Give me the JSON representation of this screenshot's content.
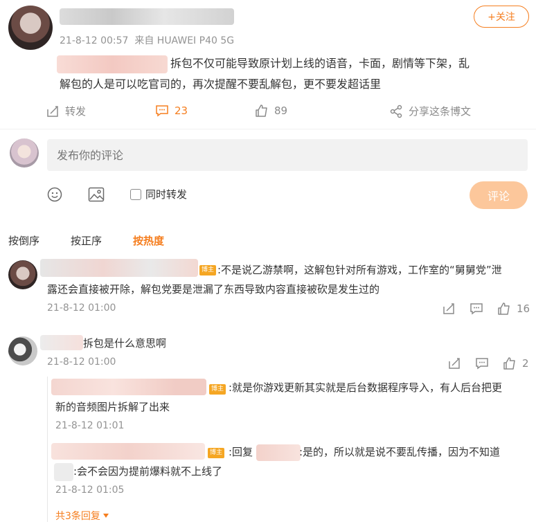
{
  "post": {
    "meta": "21-8-12 00:57  来自 HUAWEI P40 5G",
    "follow_label": "+关注",
    "text_line1": "拆包不仅可能导致原计划上线的语音，卡面，剧情等下架，乱",
    "text_line2": "解包的人是可以吃官司的，再次提醒不要乱解包，更不要发超话里",
    "actions": {
      "repost": "转发",
      "comments": "23",
      "likes": "89",
      "share": "分享这条博文"
    }
  },
  "composer": {
    "placeholder": "发布你的评论",
    "repost_label": "同时转发",
    "submit_label": "评论"
  },
  "sort": {
    "desc": "按倒序",
    "asc": "按正序",
    "hot": "按热度"
  },
  "comments": [
    {
      "badge": "博主",
      "text_line1": ":不是说乙游禁啊，这解包针对所有游戏，工作室的“舅舅党”泄",
      "text_line2": "露还会直接被开除，解包党要是泄漏了东西导致内容直接被砍是发生过的",
      "time": "21-8-12 01:00",
      "likes": "16"
    },
    {
      "text": "拆包是什么意思啊",
      "time": "21-8-12 01:00",
      "likes": "2",
      "replies": [
        {
          "badge": "博主",
          "text_line1": ":就是你游戏更新其实就是后台数据程序导入，有人后台把更",
          "text_line2": "新的音频图片拆解了出来",
          "time": "21-8-12 01:01"
        },
        {
          "badge": "博主",
          "text_a": ":回复",
          "text_b": ":是的，所以就是说不要乱传播，因为不知道",
          "text_line2": ":会不会因为提前爆料就不上线了",
          "time": "21-8-12 01:05"
        }
      ],
      "more_replies": "共3条回复"
    }
  ],
  "colors": {
    "accent": "#f57e1f",
    "badge": "#f5a623",
    "meta": "#939393"
  }
}
